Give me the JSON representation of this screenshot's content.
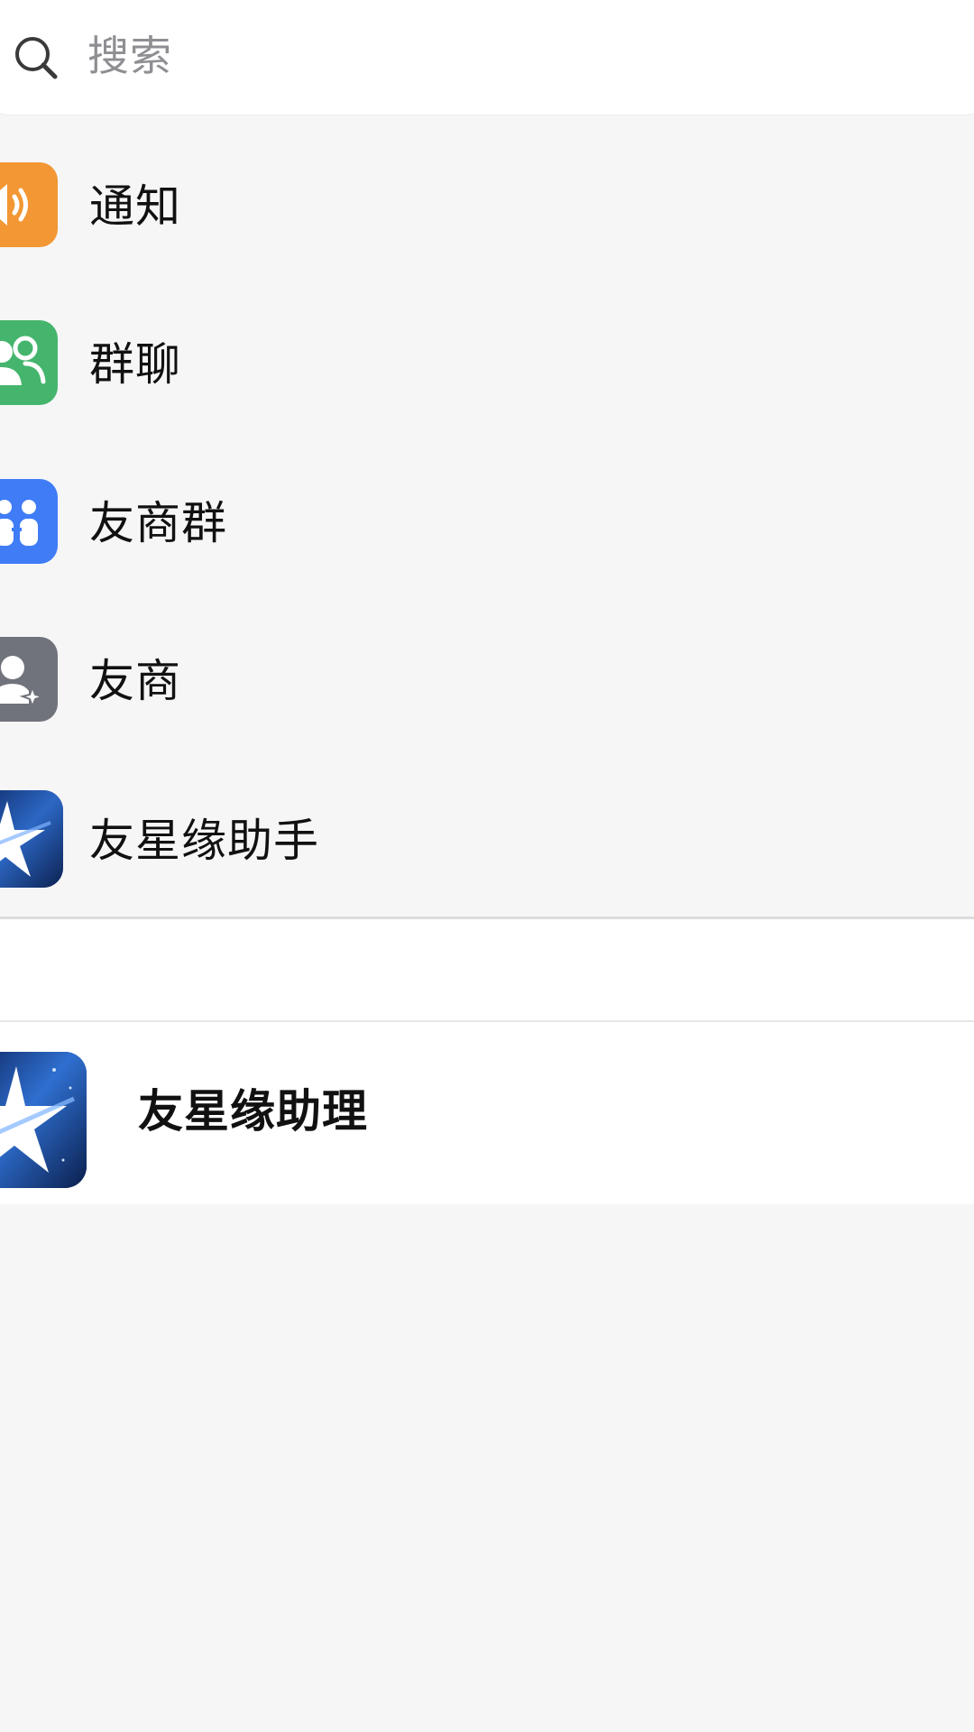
{
  "search": {
    "placeholder": "搜索",
    "icon": "search-icon"
  },
  "menu": {
    "items": [
      {
        "label": "通知",
        "icon": "speaker-icon",
        "color": "#f29733"
      },
      {
        "label": "群聊",
        "icon": "group-chat-icon",
        "color": "#45b56d"
      },
      {
        "label": "友商群",
        "icon": "partner-group-icon",
        "color": "#3f7cf6"
      },
      {
        "label": "友商",
        "icon": "partner-contact-icon",
        "color": "#70737b"
      },
      {
        "label": "友星缘助手",
        "icon": "star-logo-icon",
        "color": "#1b3d86"
      }
    ]
  },
  "assistant": {
    "label": "友星缘助理",
    "icon": "star-logo-icon"
  },
  "colors": {
    "background": "#f6f6f7",
    "surface": "#ffffff",
    "text": "#111111",
    "placeholder": "#8e8e93"
  }
}
